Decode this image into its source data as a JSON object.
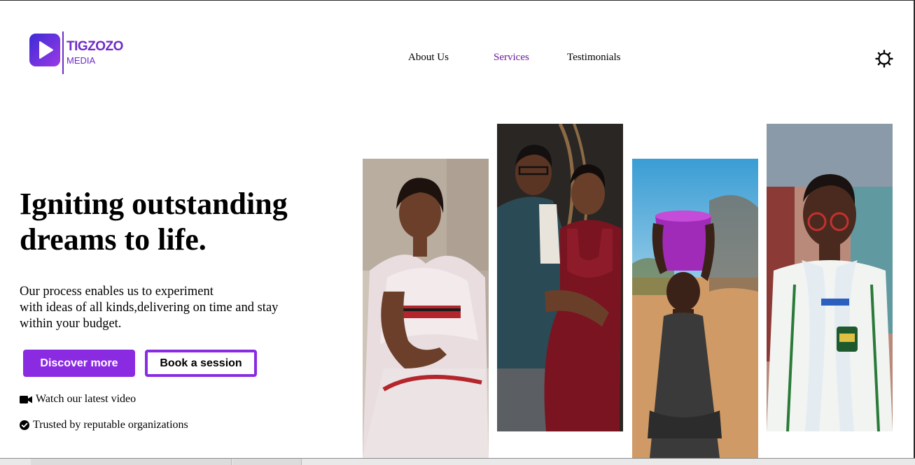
{
  "brand": {
    "name_line1": "TIGZOZO",
    "name_line2": "MEDIA",
    "color": "#6e2bc7"
  },
  "nav": {
    "items": [
      {
        "label": "About Us",
        "active": false
      },
      {
        "label": "Services",
        "active": true
      },
      {
        "label": "Testimonials",
        "active": false
      }
    ],
    "active_color": "#6a1b9a",
    "theme_toggle_icon": "sun-icon"
  },
  "hero": {
    "headline": "Igniting outstanding dreams to life.",
    "subtext_lines": [
      "Our process enables us to experiment",
      "with ideas of all kinds,delivering on time and stay",
      "within your budget."
    ],
    "primary_button": "Discover more",
    "secondary_button": "Book a session",
    "accent_color": "#8a2be2",
    "features": [
      {
        "icon": "video-camera-icon",
        "label": "Watch our latest video"
      },
      {
        "icon": "check-circle-icon",
        "label": "Trusted by reputable organizations"
      }
    ]
  },
  "gallery": {
    "photos": [
      {
        "name": "photo-woman-white-dress"
      },
      {
        "name": "photo-couple-maternity"
      },
      {
        "name": "photo-child-carrying-bucket"
      },
      {
        "name": "photo-student-uniform"
      }
    ]
  }
}
